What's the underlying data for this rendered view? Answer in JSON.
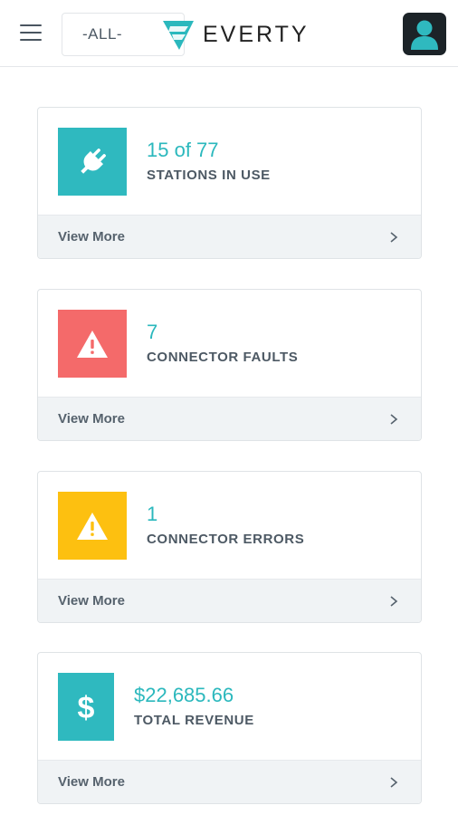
{
  "header": {
    "site_filter": "-ALL-",
    "logo_text": "EVERTY",
    "menu_icon": "hamburger-icon",
    "avatar_icon": "user-icon"
  },
  "cards": [
    {
      "value": "15 of 77",
      "label": "STATIONS IN USE",
      "link": "View More",
      "icon": "plug-icon",
      "color": "#2fb9bf"
    },
    {
      "value": "7",
      "label": "CONNECTOR FAULTS",
      "link": "View More",
      "icon": "warning-icon",
      "color": "#f46a6a"
    },
    {
      "value": "1",
      "label": "CONNECTOR ERRORS",
      "link": "View More",
      "icon": "warning-icon",
      "color": "#fdc010"
    },
    {
      "value": "$22,685.66",
      "label": "TOTAL REVENUE",
      "link": "View More",
      "icon": "dollar-icon",
      "color": "#2fb9bf"
    }
  ],
  "colors": {
    "accent": "#2bb8bd",
    "text": "#4d5964",
    "footer_bg": "#f0f3f5"
  }
}
